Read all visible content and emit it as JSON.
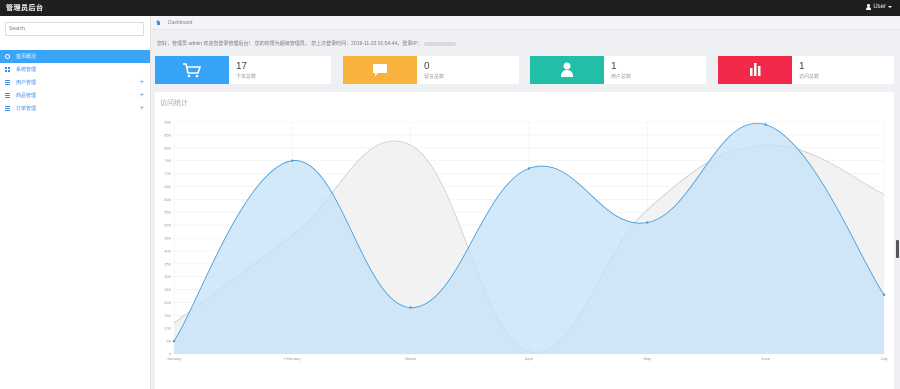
{
  "app": {
    "title": "管理员后台",
    "user": "User",
    "icons": {
      "user": "user-icon",
      "caret": "caret-down-icon"
    }
  },
  "sidebar": {
    "search_value": "Search",
    "items": [
      {
        "label": "首页概况",
        "icon": "dashboard-icon",
        "active": true,
        "expandable": false
      },
      {
        "label": "系统管理",
        "icon": "grid-icon",
        "active": false,
        "expandable": false
      },
      {
        "label": "用户管理",
        "icon": "list-icon",
        "active": false,
        "expandable": true
      },
      {
        "label": "商品管理",
        "icon": "list-icon",
        "active": false,
        "expandable": true
      },
      {
        "label": "订单管理",
        "icon": "list-icon",
        "active": false,
        "expandable": true
      }
    ]
  },
  "breadcrumb": {
    "home_icon": "home-icon",
    "current": "Dashboard"
  },
  "welcome": {
    "text": "您好，管理员 admin 欢迎您登录管理后台！ 您的权限为超级管理员。 您上次登录时间：2019-11-22 01:54:44，登录IP："
  },
  "cards": [
    {
      "count": "17",
      "label": "下单总数",
      "color": "#36a3f7",
      "icon": "cart-icon"
    },
    {
      "count": "0",
      "label": "留言总数",
      "color": "#f9b23d",
      "icon": "comment-icon"
    },
    {
      "count": "1",
      "label": "用户总数",
      "color": "#22bfa8",
      "icon": "user-icon"
    },
    {
      "count": "1",
      "label": "访问总数",
      "color": "#f3294b",
      "icon": "bar-chart-icon"
    }
  ],
  "panel": {
    "title": "访问统计"
  },
  "chart_data": {
    "type": "area",
    "categories": [
      "January",
      "February",
      "March",
      "April",
      "May",
      "June",
      "July"
    ],
    "y_ticks": [
      "0",
      "50",
      "100",
      "150",
      "200",
      "250",
      "300",
      "350",
      "400",
      "450",
      "500",
      "550",
      "600",
      "650",
      "700",
      "750",
      "800",
      "850",
      "900"
    ],
    "ylim": [
      0,
      900
    ],
    "grid": true,
    "series": [
      {
        "values": [
          120,
          460,
          810,
          10,
          560,
          810,
          620
        ],
        "color": "#cccccc",
        "fill": "#f1f1f1"
      },
      {
        "values": [
          50,
          750,
          180,
          720,
          510,
          890,
          230
        ],
        "color": "#3a9bdc",
        "fill": "#c4e0f7"
      }
    ]
  }
}
